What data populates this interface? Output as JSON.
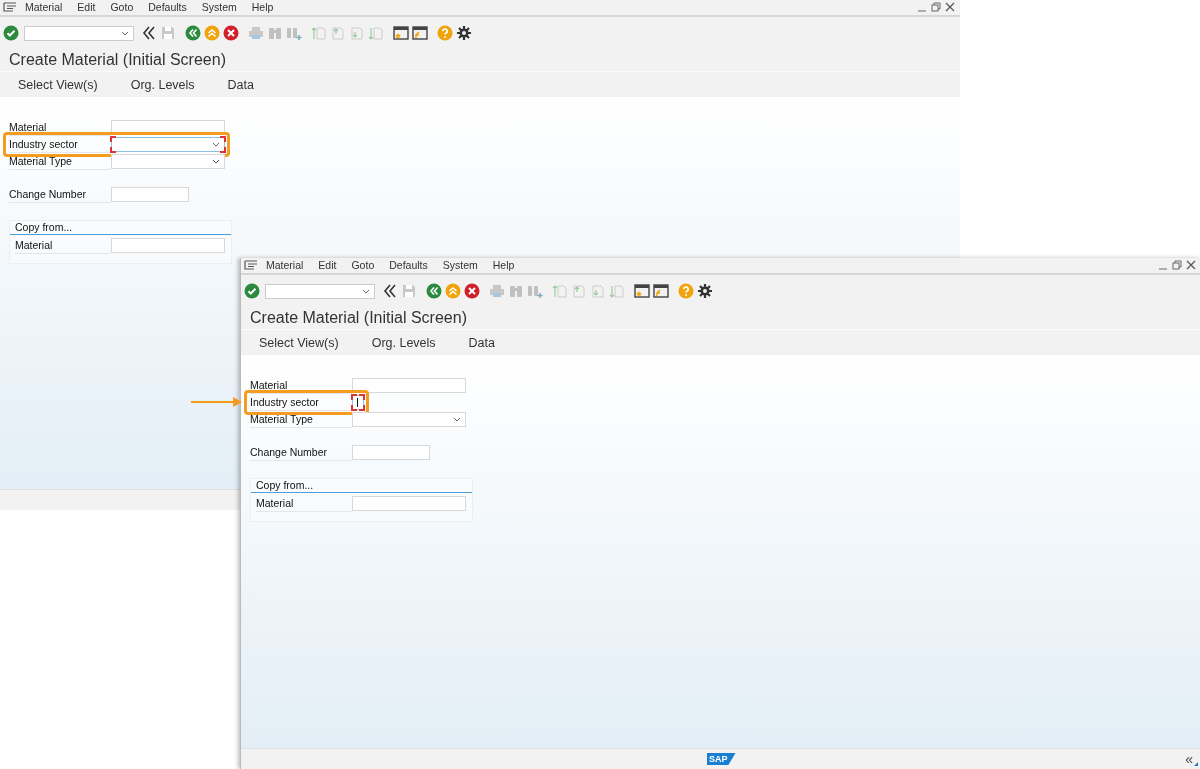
{
  "windows": [
    {
      "menu": [
        "Material",
        "Edit",
        "Goto",
        "Defaults",
        "System",
        "Help"
      ],
      "title": "Create Material (Initial Screen)",
      "tabs": [
        "Select View(s)",
        "Org. Levels",
        "Data"
      ],
      "fields": [
        {
          "label": "Material",
          "kind": "text",
          "separated": false,
          "focused": false
        },
        {
          "label": "Industry sector",
          "kind": "dropdown",
          "separated": false,
          "focused": true
        },
        {
          "label": "Material Type",
          "kind": "dropdown",
          "separated": false,
          "focused": false
        },
        {
          "label": "Change Number",
          "kind": "short",
          "separated": true,
          "focused": false
        }
      ],
      "copy_from": {
        "title": "Copy from...",
        "fields": [
          {
            "label": "Material",
            "kind": "text"
          }
        ]
      }
    },
    {
      "menu": [
        "Material",
        "Edit",
        "Goto",
        "Defaults",
        "System",
        "Help"
      ],
      "title": "Create Material (Initial Screen)",
      "tabs": [
        "Select View(s)",
        "Org. Levels",
        "Data"
      ],
      "pointer_arrow": true,
      "fields": [
        {
          "label": "Material",
          "kind": "text",
          "separated": false,
          "focused": false
        },
        {
          "label": "Industry sector",
          "kind": "cursor",
          "separated": false,
          "focused": true
        },
        {
          "label": "Material Type",
          "kind": "dropdown",
          "separated": false,
          "focused": false
        },
        {
          "label": "Change Number",
          "kind": "short",
          "separated": true,
          "focused": false
        }
      ],
      "copy_from": {
        "title": "Copy from...",
        "fields": [
          {
            "label": "Material",
            "kind": "text"
          }
        ]
      },
      "status_bar": {
        "logo": "SAP",
        "expander": "«"
      }
    }
  ]
}
